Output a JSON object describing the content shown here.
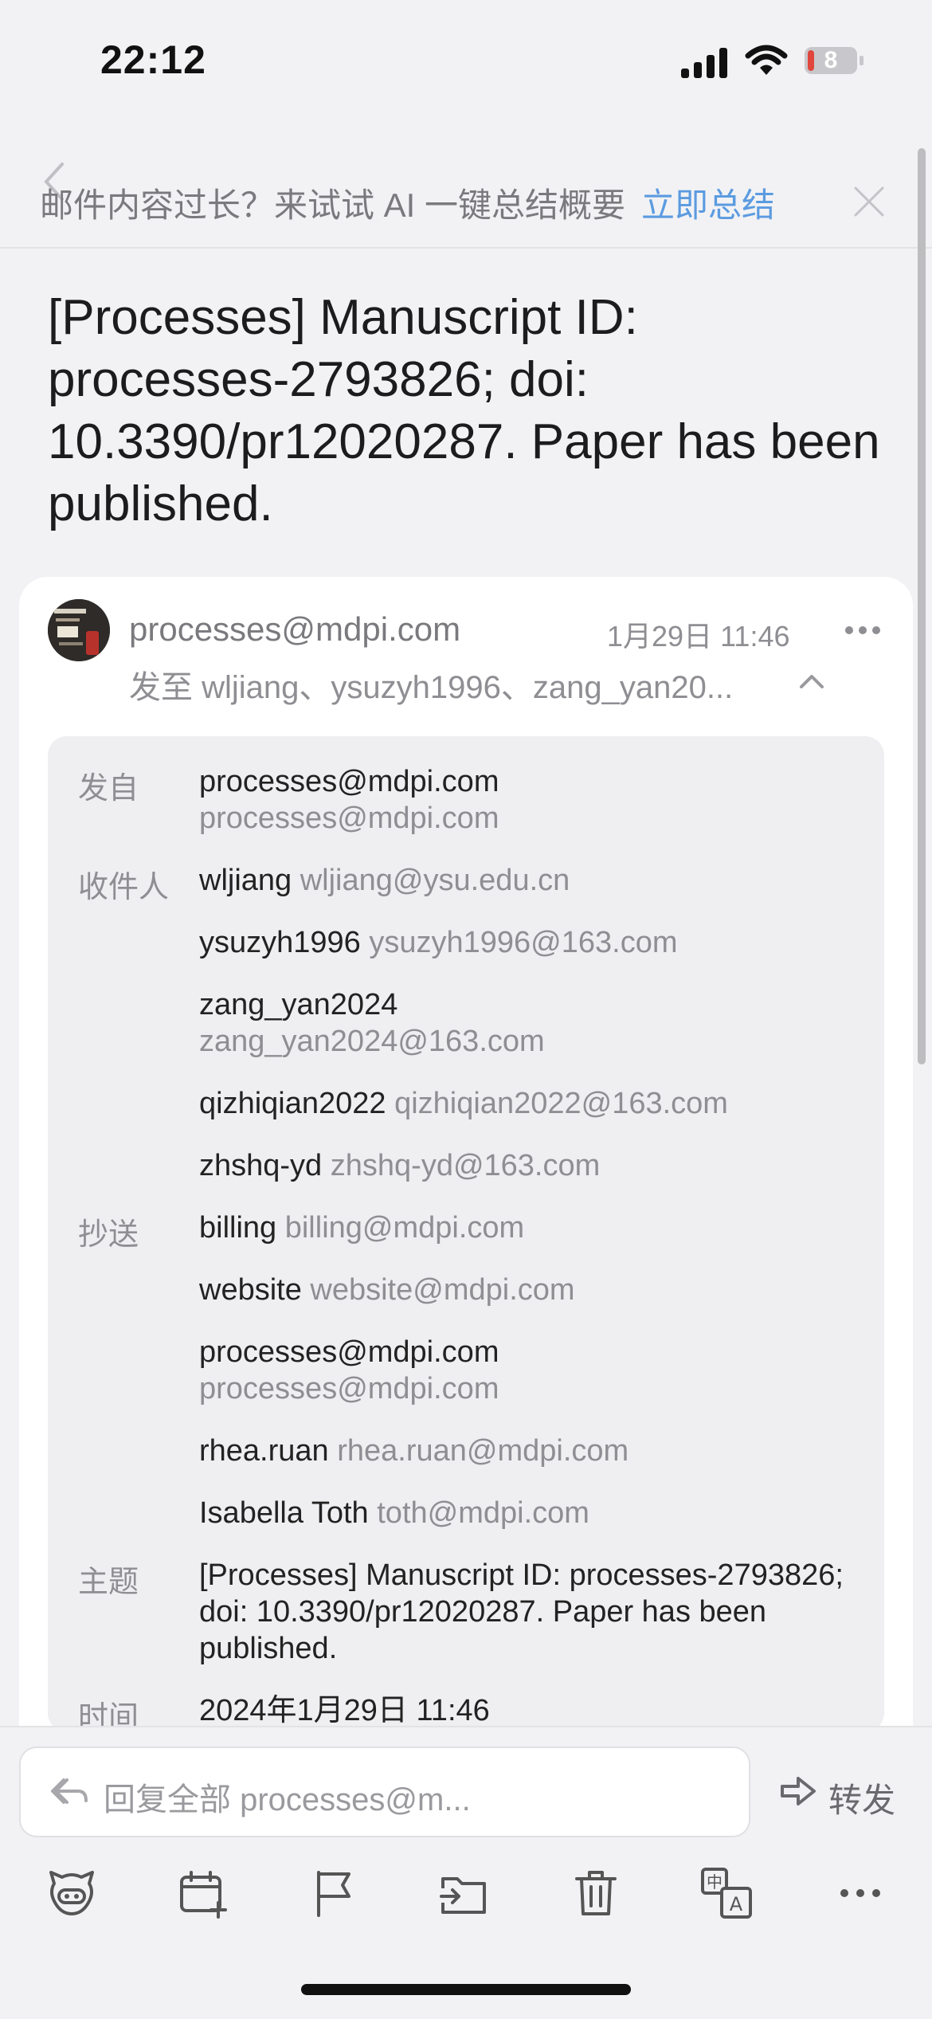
{
  "status": {
    "time": "22:12",
    "battery": "8"
  },
  "banner": {
    "text": "邮件内容过长？来试试 AI 一键总结概要",
    "link": "立即总结"
  },
  "subject": "[Processes] Manuscript ID: processes-2793826; doi: 10.3390/pr12020287. Paper has been published.",
  "header": {
    "sender": "processes@mdpi.com",
    "date": "1月29日 11:46",
    "to_line": "发至 wljiang、ysuzyh1996、zang_yan20..."
  },
  "details": {
    "from_label": "发自",
    "from_name": "processes@mdpi.com",
    "from_email": "processes@mdpi.com",
    "to_label": "收件人",
    "to": [
      {
        "name": "wljiang",
        "email": "wljiang@ysu.edu.cn"
      },
      {
        "name": "ysuzyh1996",
        "email": "ysuzyh1996@163.com"
      },
      {
        "name": "zang_yan2024",
        "email": "zang_yan2024@163.com"
      },
      {
        "name": "qizhiqian2022",
        "email": "qizhiqian2022@163.com"
      },
      {
        "name": "zhshq-yd",
        "email": "zhshq-yd@163.com"
      }
    ],
    "cc_label": "抄送",
    "cc": [
      {
        "name": "billing",
        "email": "billing@mdpi.com"
      },
      {
        "name": "website",
        "email": "website@mdpi.com"
      },
      {
        "name": "processes@mdpi.com",
        "email": "processes@mdpi.com"
      },
      {
        "name": "rhea.ruan",
        "email": "rhea.ruan@mdpi.com"
      },
      {
        "name": "Isabella Toth",
        "email": "toth@mdpi.com"
      }
    ],
    "subject_label": "主题",
    "subject_value": "[Processes] Manuscript ID: processes-2793826; doi: 10.3390/pr12020287. Paper has been published.",
    "time_label": "时间",
    "time_value": "2024年1月29日 11:46"
  },
  "bottom": {
    "reply_text": "回复全部  processes@m...",
    "forward": "转发"
  },
  "toolbar_icons": [
    "ai-assistant-icon",
    "add-calendar-icon",
    "flag-icon",
    "move-folder-icon",
    "trash-icon",
    "translate-icon",
    "more-icon"
  ],
  "colors": {
    "link": "#5b9be0",
    "muted": "#8e8e93",
    "panel": "#efeff1"
  }
}
